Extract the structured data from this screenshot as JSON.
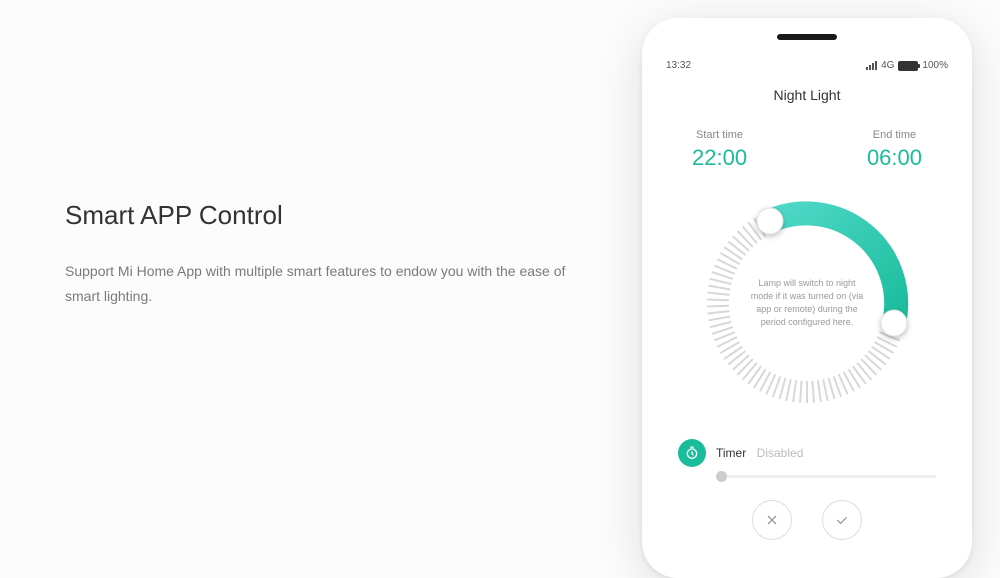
{
  "marketing": {
    "headline": "Smart APP Control",
    "description": "Support Mi Home App with multiple smart features to endow you with the ease of smart lighting."
  },
  "phone": {
    "status": {
      "time": "13:32",
      "network": "4G",
      "battery": "100%"
    },
    "app_title": "Night Light",
    "start": {
      "label": "Start time",
      "value": "22:00"
    },
    "end": {
      "label": "End time",
      "value": "06:00"
    },
    "dial_text": "Lamp will switch to night mode if it was turned on (via app or remote) during the period configured here.",
    "timer": {
      "label": "Timer",
      "status": "Disabled"
    },
    "colors": {
      "accent": "#1abc9c"
    }
  }
}
